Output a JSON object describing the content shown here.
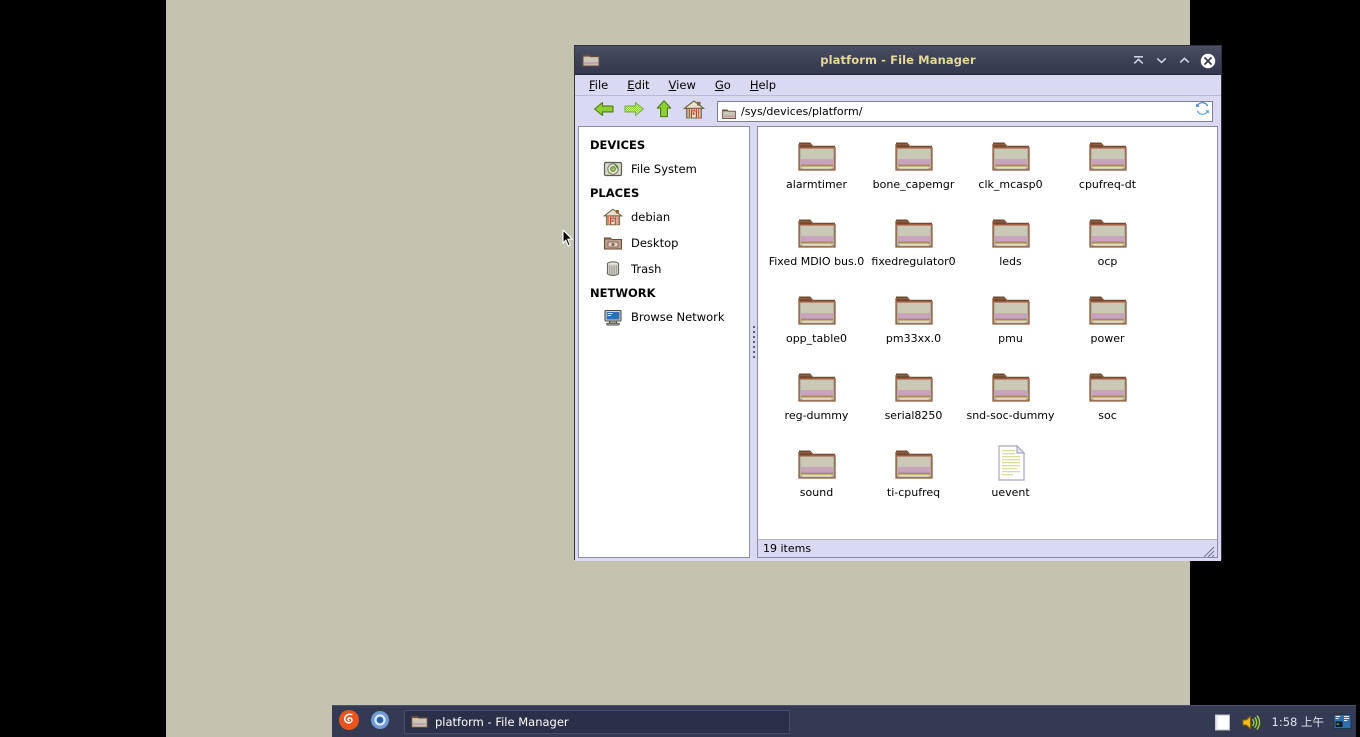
{
  "window": {
    "title": "platform - File Manager",
    "icon": "folder-icon",
    "buttons": [
      {
        "name": "shade-button",
        "glyph": "shade"
      },
      {
        "name": "minimize-button",
        "glyph": "minimize"
      },
      {
        "name": "maximize-button",
        "glyph": "maximize"
      },
      {
        "name": "close-button",
        "glyph": "close"
      }
    ]
  },
  "menubar": {
    "items": [
      {
        "label": "File",
        "mnemonic": "F"
      },
      {
        "label": "Edit",
        "mnemonic": "E"
      },
      {
        "label": "View",
        "mnemonic": "V"
      },
      {
        "label": "Go",
        "mnemonic": "G"
      },
      {
        "label": "Help",
        "mnemonic": "H"
      }
    ]
  },
  "toolbar": {
    "back": "back-arrow-icon",
    "forward": "forward-arrow-icon",
    "up": "up-arrow-icon",
    "home": "home-icon",
    "reload": "reload-icon",
    "path": "/sys/devices/platform/",
    "path_placeholder": "/sys/devices/platform/"
  },
  "sidebar": {
    "groups": [
      {
        "header": "DEVICES",
        "items": [
          {
            "label": "File System",
            "icon": "harddisk-icon",
            "name": "sidebar-item-file-system"
          }
        ]
      },
      {
        "header": "PLACES",
        "items": [
          {
            "label": "debian",
            "icon": "home-icon",
            "name": "sidebar-item-debian"
          },
          {
            "label": "Desktop",
            "icon": "desktop-folder-icon",
            "name": "sidebar-item-desktop"
          },
          {
            "label": "Trash",
            "icon": "trash-icon",
            "name": "sidebar-item-trash"
          }
        ]
      },
      {
        "header": "NETWORK",
        "items": [
          {
            "label": "Browse Network",
            "icon": "network-icon",
            "name": "sidebar-item-browse-network"
          }
        ]
      }
    ]
  },
  "files": [
    {
      "label": "alarmtimer",
      "type": "folder"
    },
    {
      "label": "bone_capemgr",
      "type": "folder"
    },
    {
      "label": "clk_mcasp0",
      "type": "folder"
    },
    {
      "label": "cpufreq-dt",
      "type": "folder"
    },
    {
      "label": "Fixed MDIO bus.0",
      "type": "folder"
    },
    {
      "label": "fixedregulator0",
      "type": "folder"
    },
    {
      "label": "leds",
      "type": "folder"
    },
    {
      "label": "ocp",
      "type": "folder"
    },
    {
      "label": "opp_table0",
      "type": "folder"
    },
    {
      "label": "pm33xx.0",
      "type": "folder"
    },
    {
      "label": "pmu",
      "type": "folder"
    },
    {
      "label": "power",
      "type": "folder"
    },
    {
      "label": "reg-dummy",
      "type": "folder"
    },
    {
      "label": "serial8250",
      "type": "folder"
    },
    {
      "label": "snd-soc-dummy",
      "type": "folder"
    },
    {
      "label": "soc",
      "type": "folder"
    },
    {
      "label": "sound",
      "type": "folder"
    },
    {
      "label": "ti-cpufreq",
      "type": "folder"
    },
    {
      "label": "uevent",
      "type": "file"
    }
  ],
  "statusbar": {
    "text": "19 items"
  },
  "taskbar": {
    "launchers": [
      {
        "name": "applications-menu-button",
        "icon": "debian-swirl-icon"
      },
      {
        "name": "chromium-launcher",
        "icon": "chromium-icon"
      }
    ],
    "task": {
      "label": "platform - File Manager",
      "icon": "folder-icon"
    },
    "tray": {
      "notes_icon": "notes-icon",
      "volume_icon": "speaker-icon",
      "clock": "1:58 上午",
      "terminal_icon": "terminal-icon"
    }
  },
  "colors": {
    "desktop_bg": "#c3c3b0",
    "titlebar": "#3c4154",
    "title_text": "#e7d79a",
    "chrome": "#d9d9f2",
    "taskbar": "#343a52",
    "folder_body": "#c8c8b4",
    "folder_tab": "#6e4b33",
    "folder_band": "#c3a0b8"
  }
}
